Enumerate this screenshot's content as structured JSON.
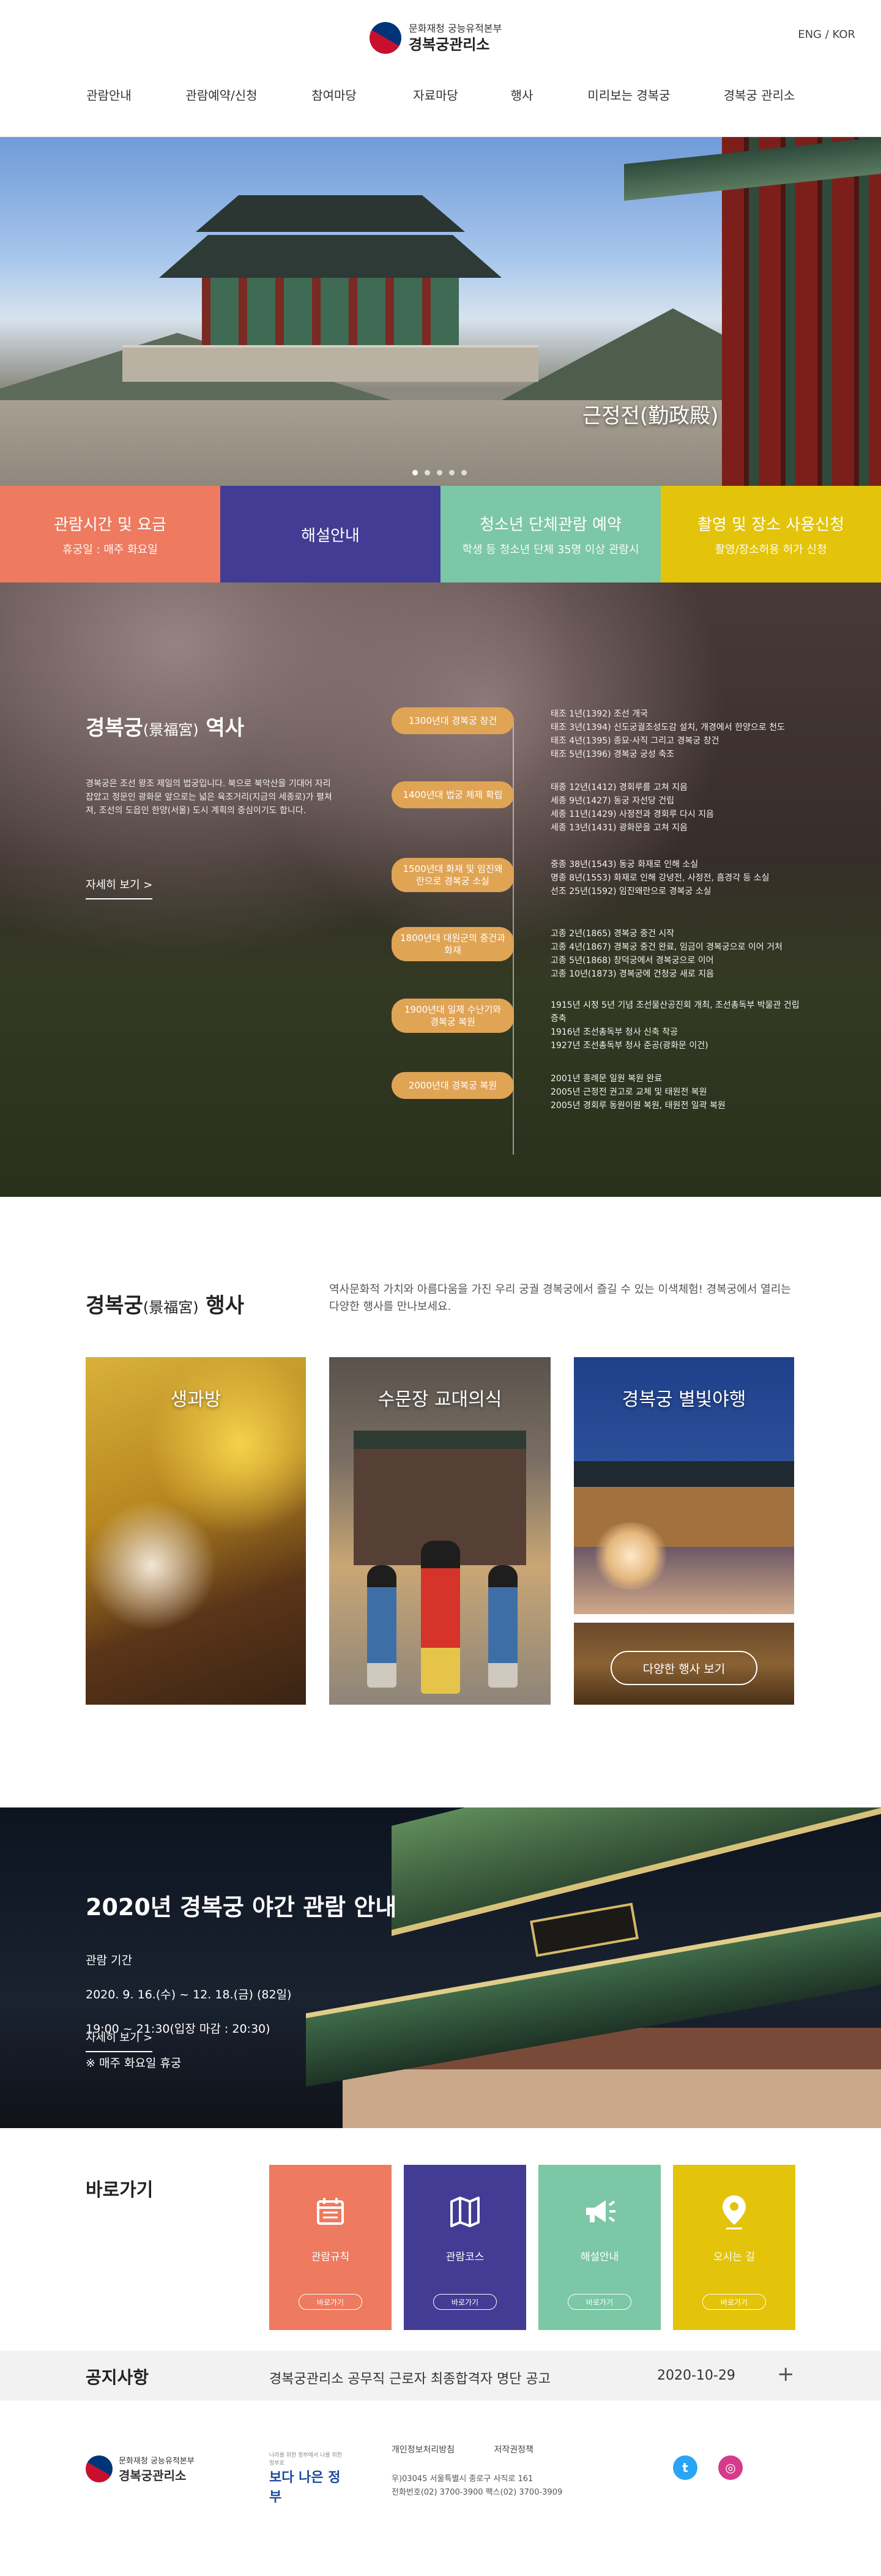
{
  "header": {
    "org_sub": "문화재청 궁능유적본부",
    "org_main": "경복궁관리소",
    "lang": "ENG / KOR",
    "nav": [
      "관람안내",
      "관람예약/신청",
      "참여마당",
      "자료마당",
      "행사",
      "미리보는 경복궁",
      "경복궁 관리소"
    ]
  },
  "hero": {
    "caption": "근정전(勤政殿)",
    "slide_count": 5,
    "active_slide": 1
  },
  "tiles": [
    {
      "title": "관람시간 및 요금",
      "sub": "휴궁일 : 매주 화요일",
      "color": "#ee7a5f"
    },
    {
      "title": "해설안내",
      "sub": "",
      "color": "#423c94"
    },
    {
      "title": "청소년 단체관람 예약",
      "sub": "학생 등 청소년 단체 35명 이상 관람시",
      "color": "#7cc7a5"
    },
    {
      "title": "촬영 및 장소 사용신청",
      "sub": "촬영/장소허용 허가 신청",
      "color": "#e3c40a"
    }
  ],
  "history": {
    "title": "경복궁",
    "title_hanja": "(景福宮)",
    "title_suffix": " 역사",
    "desc": "경복궁은 조선 왕조 제일의 법궁입니다. 북으로 북악산을 기대어 자리 잡았고 정문인 광화문 앞으로는 넓은 육조거리(지금의 세종로)가 펼쳐져, 조선의 도읍인 한양(서울) 도시 계획의 중심이기도 합니다.",
    "more": "자세히 보기 >",
    "eras": [
      {
        "label": "1300년대 경복궁 창건",
        "details": [
          "태조 1년(1392) 조선 개국",
          "태조 3년(1394) 신도궁궐조성도감 설치, 개경에서 한양으로 천도",
          "태조 4년(1395) 종묘·사직 그리고 경복궁 창건",
          "태조 5년(1396) 경복궁 궁성 축조"
        ]
      },
      {
        "label": "1400년대 법궁 체제 확립",
        "details": [
          "태종 12년(1412) 경회루를 고쳐 지음",
          "세종 9년(1427) 동궁 자선당 건립",
          "세종 11년(1429) 사정전과 경회루 다시 지음",
          "세종 13년(1431) 광화문을 고쳐 지음"
        ]
      },
      {
        "label": "1500년대 화재 및 임진왜란으로 경복궁 소실",
        "details": [
          "중종 38년(1543) 동궁 화재로 인해 소실",
          "명종 8년(1553) 화재로 인해 강녕전, 사정전, 흠경각 등 소실",
          "선조 25년(1592) 임진왜란으로 경복궁 소실"
        ]
      },
      {
        "label": "1800년대 대원군의 중건과 화재",
        "details": [
          "고종 2년(1865) 경복궁 중건 시작",
          "고종 4년(1867) 경복궁 중건 완료, 임금이 경복궁으로 이어 거처",
          "고종 5년(1868) 창덕궁에서 경복궁으로 이어",
          "고종 10년(1873) 경복궁에 건청궁 새로 지음"
        ]
      },
      {
        "label": "1900년대 일제 수난기와 경복궁 복원",
        "details": [
          "1915년 시정 5년 기념 조선물산공진회 개최, 조선총독부 박물관 건립 증축",
          "1916년 조선총독부 청사 신축 착공",
          "1927년 조선총독부 청사 준공(광화문 이건)"
        ]
      },
      {
        "label": "2000년대 경복궁 복원",
        "details": [
          "2001년 흥례문 일원 복원 완료",
          "2005년 근정전 권고로 교체 및 태원전 복원",
          "2005년 경회루 동원이원 복원, 태원전 일곽 복원"
        ]
      }
    ]
  },
  "events": {
    "title": "경복궁",
    "title_hanja": "(景福宮)",
    "title_suffix": " 행사",
    "desc": "역사문화적 가치와 아름다움을 가진 우리 궁궐 경복궁에서 즐길 수 있는 이색체험! 경복궁에서 열리는 다양한 행사를 만나보세요.",
    "cards": [
      "생과방",
      "수문장 교대의식",
      "경복궁 별빛야행"
    ],
    "more_button": "다양한 행사 보기"
  },
  "night": {
    "title": "2020년 경복궁 야간 관람 안내",
    "period_label": "관람 기간",
    "period": " 2020. 9. 16.(수) ~ 12. 18.(금) (82일)",
    "hours": "19:00 ~ 21:30(입장 마감 : 20:30)",
    "closed": "※ 매주 화요일 휴궁",
    "more": "자세히 보기 >"
  },
  "shortcut": {
    "title": "바로가기",
    "items": [
      {
        "label": "관람규칙",
        "button": "바로가기",
        "icon": "calendar-icon",
        "color": "#ee7a5f"
      },
      {
        "label": "관람코스",
        "button": "바로가기",
        "icon": "map-icon",
        "color": "#423c94"
      },
      {
        "label": "해설안내",
        "button": "바로가기",
        "icon": "megaphone-icon",
        "color": "#7cc7a5"
      },
      {
        "label": "오시는 길",
        "button": "바로가기",
        "icon": "location-pin-icon",
        "color": "#e3c40a"
      }
    ]
  },
  "notice": {
    "title": "공지사항",
    "latest": "경복궁관리소 공무직 근로자 최종합격자 명단 공고",
    "date": "2020-10-29",
    "plus": "+"
  },
  "footer": {
    "org_sub": "문화재청 궁능유적본부",
    "org_main": "경복궁관리소",
    "slogan_small": "나라를 위한 정부에서 나를 위한 정부로",
    "slogan_big": "보다 나은 정부",
    "links": [
      "개인정보처리방침",
      "저작권정책"
    ],
    "address": "우)03045 서울특별시 종로구 사직로 161",
    "contact": "전화번호(02) 3700-3900 팩스(02) 3700-3909",
    "sns": [
      {
        "name": "twitter",
        "glyph": "t",
        "color": "#2aa4f4"
      },
      {
        "name": "instagram",
        "glyph": "◎",
        "color": "#d63a8a"
      }
    ]
  }
}
